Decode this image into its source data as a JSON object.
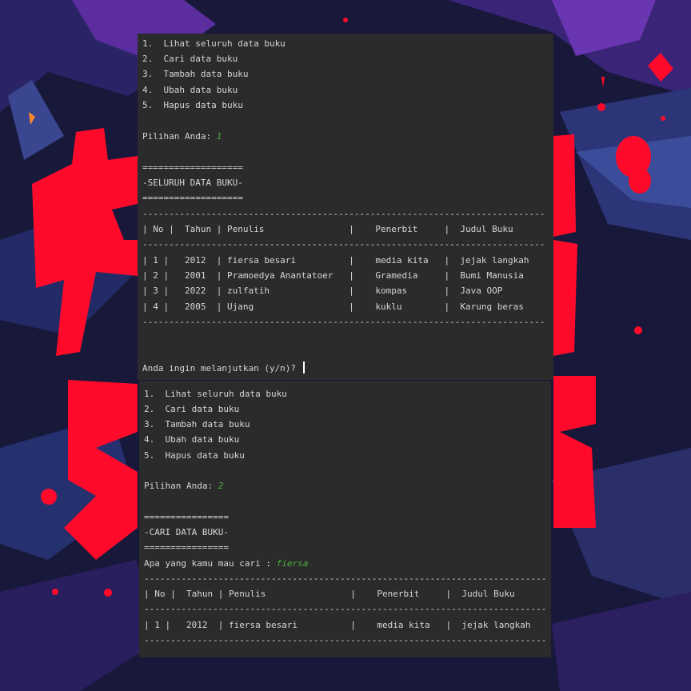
{
  "top_terminal": {
    "menu": [
      "1.  Lihat seluruh data buku",
      "2.  Cari data buku",
      "3.  Tambah data buku",
      "4.  Ubah data buku",
      "5.  Hapus data buku"
    ],
    "prompt_label": "Pilihan Anda: ",
    "prompt_value": "1",
    "header_rule": "===================",
    "section_title": "-SELURUH DATA BUKU-",
    "table_rule": "----------------------------------------------------------------------------",
    "table_header": "| No |  Tahun | Penulis                |    Penerbit     |  Judul Buku",
    "rows": [
      "| 1 |   2012  | fiersa besari          |    media kita   |  jejak langkah",
      "| 2 |   2001  | Pramoedya Anantatoer   |    Gramedia     |  Bumi Manusia",
      "| 3 |   2022  | zulfatih               |    kompas       |  Java OOP",
      "| 4 |   2005  | Ujang                  |    kuklu        |  Karung beras"
    ],
    "continue_prompt": "Anda ingin melanjutkan (y/n)? "
  },
  "bottom_terminal": {
    "menu": [
      "1.  Lihat seluruh data buku",
      "2.  Cari data buku",
      "3.  Tambah data buku",
      "4.  Ubah data buku",
      "5.  Hapus data buku"
    ],
    "prompt_label": "Pilihan Anda: ",
    "prompt_value": "2",
    "header_rule": "================",
    "section_title": "-CARI DATA BUKU-",
    "search_label": "Apa yang kamu mau cari : ",
    "search_value": "fiersa",
    "table_rule": "----------------------------------------------------------------------------",
    "table_header": "| No |  Tahun | Penulis                |    Penerbit     |  Judul Buku",
    "rows": [
      "| 1 |   2012  | fiersa besari          |    media kita   |  jejak langkah"
    ]
  },
  "colors": {
    "terminal_bg": "#2b2b2b",
    "terminal_text": "#d6d6d6",
    "input_text": "#4caf3f",
    "wallpaper_bg": "#17183a",
    "wallpaper_accent": "#ff0a2a",
    "wallpaper_purple": "#5b2d9e"
  }
}
